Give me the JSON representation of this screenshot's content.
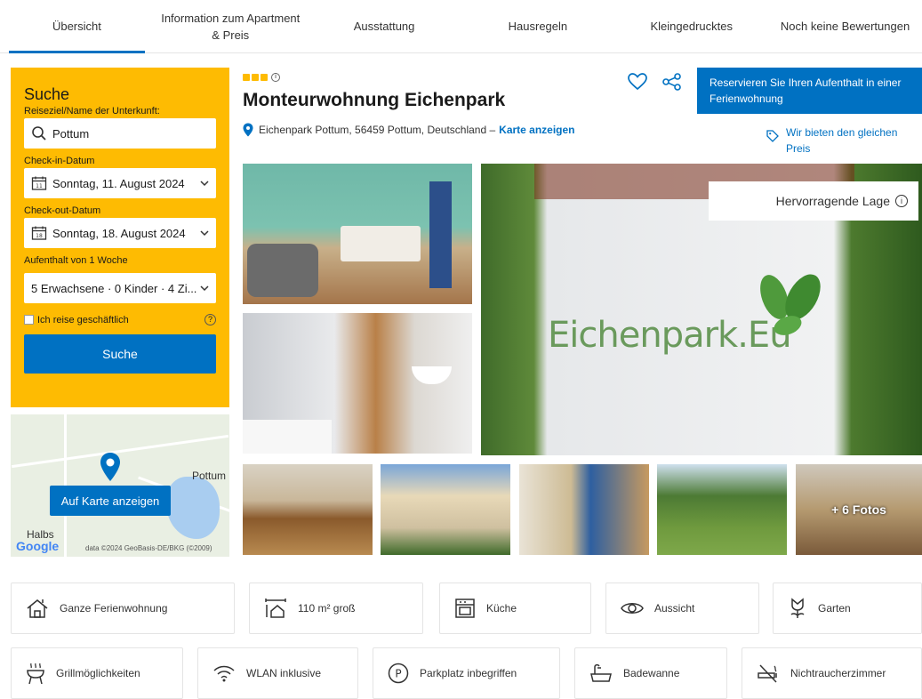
{
  "nav": {
    "tabs": [
      {
        "label": "Übersicht"
      },
      {
        "label": "Information zum Apartment & Preis"
      },
      {
        "label": "Ausstattung"
      },
      {
        "label": "Hausregeln"
      },
      {
        "label": "Kleingedrucktes"
      },
      {
        "label": "Noch keine Bewertungen"
      }
    ]
  },
  "search": {
    "title": "Suche",
    "destination_label": "Reiseziel/Name der Unterkunft:",
    "destination_value": "Pottum",
    "checkin_label": "Check-in-Datum",
    "checkin_value": "Sonntag, 11. August 2024",
    "checkin_day": "11",
    "checkout_label": "Check-out-Datum",
    "checkout_value": "Sonntag, 18. August 2024",
    "checkout_day": "18",
    "stay_label": "Aufenthalt von 1 Woche",
    "guests_value": "5 Erwachsene · 0 Kinder · 4 Zi...",
    "business_label": "Ich reise geschäftlich",
    "help": "?",
    "button": "Suche"
  },
  "map": {
    "button": "Auf Karte anzeigen",
    "place1": "Pottum",
    "place2": "Halbs",
    "google": "Google",
    "attribution": "data ©2024 GeoBasis-DE/BKG (©2009)"
  },
  "property": {
    "stars": 3,
    "info": "i",
    "title": "Monteurwohnung Eichenpark",
    "address": "Eichenpark Pottum, 56459 Pottum, Deutschland –",
    "map_link": "Karte anzeigen",
    "reserve": "Reservieren Sie Ihren Aufenthalt in einer Ferienwohnung",
    "price_match": "Wir bieten den gleichen Preis",
    "badge": "Hervorragende Lage",
    "sign_text": "Eichenpark.Eu",
    "more_photos": "+ 6 Fotos"
  },
  "facilities": [
    {
      "label": "Ganze Ferienwohnung",
      "icon": "house-icon"
    },
    {
      "label": "110 m² groß",
      "icon": "size-icon"
    },
    {
      "label": "Küche",
      "icon": "kitchen-icon"
    },
    {
      "label": "Aussicht",
      "icon": "eye-icon"
    },
    {
      "label": "Garten",
      "icon": "flower-icon"
    },
    {
      "label": "Grillmöglichkeiten",
      "icon": "grill-icon"
    },
    {
      "label": "WLAN inklusive",
      "icon": "wifi-icon"
    },
    {
      "label": "Parkplatz inbegriffen",
      "icon": "parking-icon"
    },
    {
      "label": "Badewanne",
      "icon": "bathtub-icon"
    },
    {
      "label": "Nichtraucherzimmer",
      "icon": "no-smoking-icon"
    }
  ],
  "colors": {
    "accent": "#0071c2",
    "search_bg": "#febb02"
  }
}
